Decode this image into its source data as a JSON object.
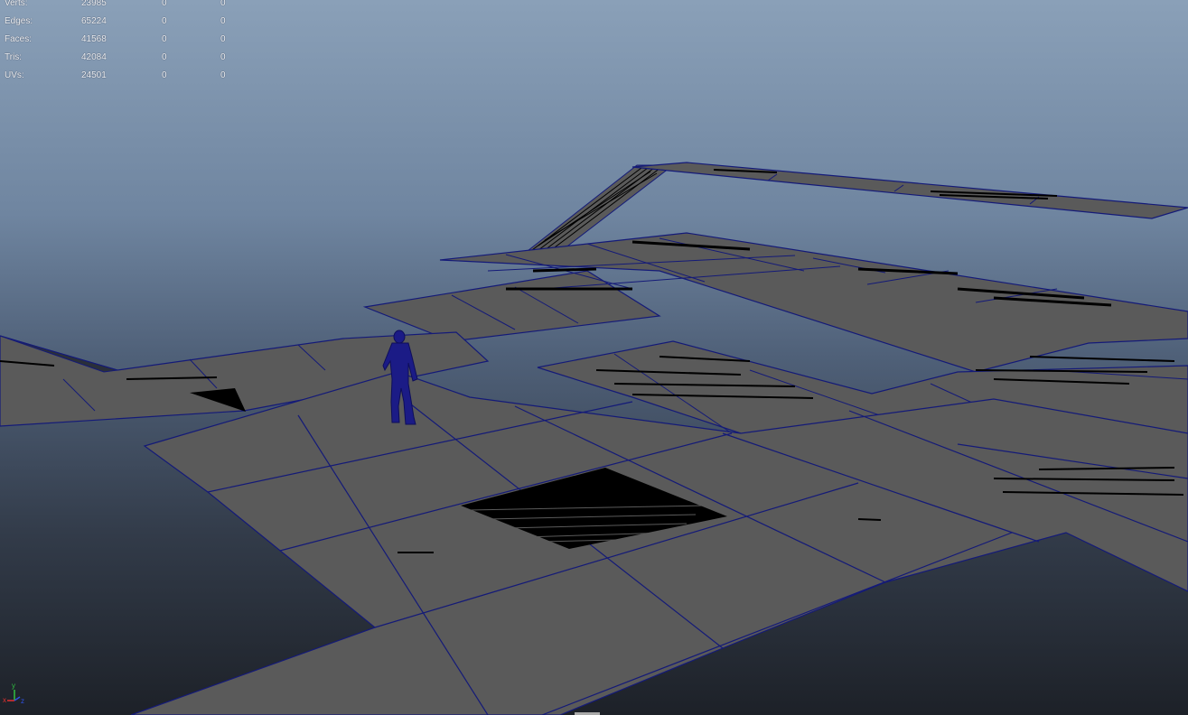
{
  "hud": {
    "rows": [
      {
        "label": "Verts:",
        "total": "23985",
        "selected": "0",
        "components": "0"
      },
      {
        "label": "Edges:",
        "total": "65224",
        "selected": "0",
        "components": "0"
      },
      {
        "label": "Faces:",
        "total": "41568",
        "selected": "0",
        "components": "0"
      },
      {
        "label": "Tris:",
        "total": "42084",
        "selected": "0",
        "components": "0"
      },
      {
        "label": "UVs:",
        "total": "24501",
        "selected": "0",
        "components": "0"
      }
    ]
  },
  "axis_gizmo": {
    "x_label": "x",
    "y_label": "y",
    "z_label": "z"
  },
  "colors": {
    "plane_fill": "#5a5a5a",
    "wire": "#141a78",
    "character": "#1b1b86",
    "sky_top": "#8aa0b8",
    "ground_bottom": "#1d2128",
    "axis_x": "#e03030",
    "axis_y": "#30c040",
    "axis_z": "#3050e0"
  }
}
